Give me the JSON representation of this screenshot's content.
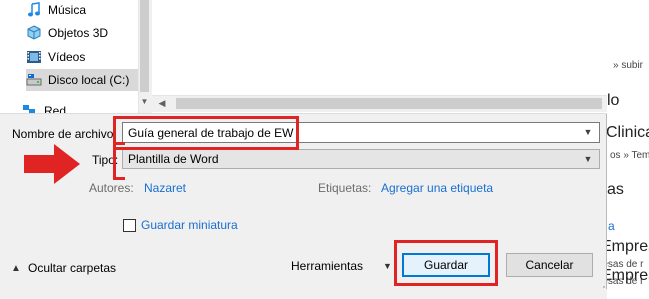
{
  "nav": {
    "items": [
      {
        "label": "Música",
        "icon": "music-icon"
      },
      {
        "label": "Objetos 3D",
        "icon": "3d-objects-icon"
      },
      {
        "label": "Vídeos",
        "icon": "videos-icon"
      },
      {
        "label": "Disco local (C:)",
        "icon": "local-disk-icon",
        "selected": true
      }
    ],
    "partial_item": "Red"
  },
  "form": {
    "filename_label": "Nombre de archivo:",
    "filename_value": "Guía general de trabajo de EW",
    "type_label": "Tipo:",
    "type_value": "Plantilla de Word",
    "authors_label": "Autores:",
    "authors_value": "Nazaret",
    "tags_label": "Etiquetas:",
    "tags_link": "Agregar una etiqueta",
    "thumbnail_label": "Guardar miniatura",
    "thumbnail_checked": false
  },
  "footer": {
    "hide_folders": "Ocultar carpetas",
    "tools": "Herramientas",
    "save": "Guardar",
    "cancel": "Cancelar"
  },
  "background": {
    "texts": [
      "» subir",
      "lo",
      "Clinica",
      "os » Tem",
      "as",
      "a",
      "Empresas de r",
      "resas de r",
      "Empresas de r",
      "resas de r",
      "Empresas de r"
    ]
  },
  "colors": {
    "highlight": "#e02424",
    "link": "#1a6fd1",
    "primary_border": "#0078d7"
  }
}
